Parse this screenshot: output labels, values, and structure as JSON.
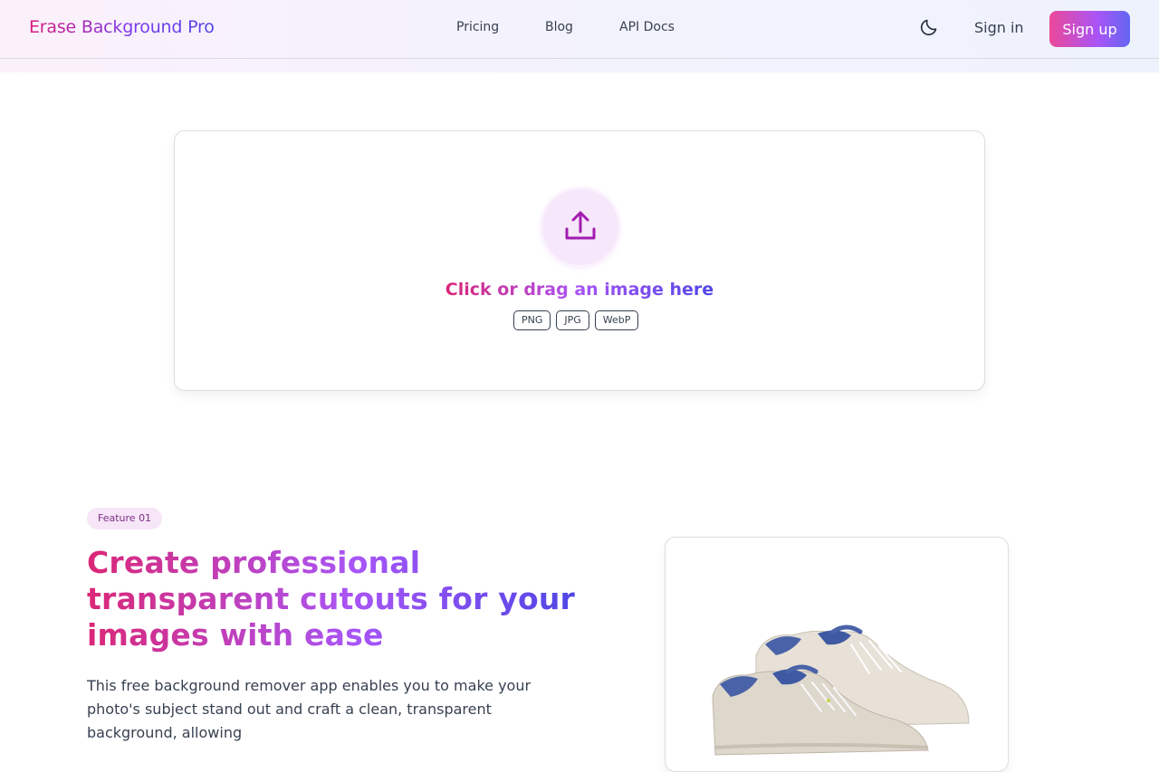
{
  "header": {
    "logo": "Erase Background Pro",
    "nav": [
      "Pricing",
      "Blog",
      "API Docs"
    ],
    "theme_toggle_icon": "moon-icon",
    "sign_in": "Sign in",
    "sign_up": "Sign up"
  },
  "upload": {
    "icon": "upload-icon",
    "title": "Click or drag an image here",
    "formats": [
      "PNG",
      "JPG",
      "WebP"
    ]
  },
  "feature": {
    "badge": "Feature 01",
    "headline": "Create professional transparent cutouts for your images with ease",
    "description": "This free background remover app enables you to make your photo's subject stand out and craft a clean, transparent background, allowing",
    "image_icon": "sneakers-image"
  },
  "colors": {
    "brand_pink": "#db2777",
    "brand_purple": "#a855f7",
    "brand_indigo": "#4f46e5"
  }
}
